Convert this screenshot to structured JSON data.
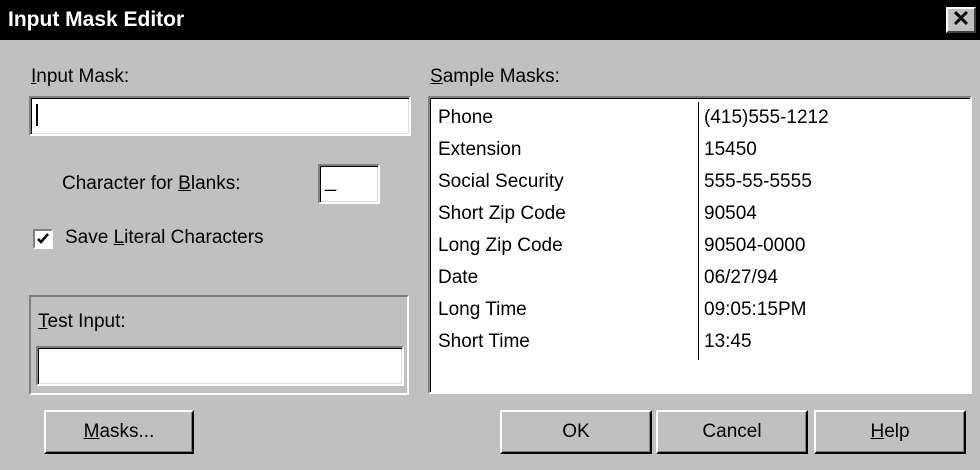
{
  "window": {
    "title": "Input Mask Editor",
    "close_glyph": "✕"
  },
  "input_mask": {
    "label_accel": "I",
    "label_rest": "nput Mask:",
    "value": ""
  },
  "blanks": {
    "label_pre": "Character for ",
    "label_accel": "B",
    "label_post": "lanks:",
    "value": "_"
  },
  "save_literal": {
    "label_pre": "Save ",
    "label_accel": "L",
    "label_post": "iteral Characters",
    "checked": true
  },
  "test_input": {
    "label_accel": "T",
    "label_rest": "est Input:",
    "value": ""
  },
  "sample_masks": {
    "label_accel": "S",
    "label_rest": "ample Masks:",
    "rows": [
      {
        "name": "Phone",
        "sample": "(415)555-1212"
      },
      {
        "name": "Extension",
        "sample": "15450"
      },
      {
        "name": "Social Security",
        "sample": "555-55-5555"
      },
      {
        "name": "Short Zip Code",
        "sample": "90504"
      },
      {
        "name": "Long Zip Code",
        "sample": "90504-0000"
      },
      {
        "name": "Date",
        "sample": "06/27/94"
      },
      {
        "name": "Long Time",
        "sample": "09:05:15PM"
      },
      {
        "name": "Short Time",
        "sample": "13:45"
      }
    ]
  },
  "buttons": {
    "masks_accel": "M",
    "masks_rest": "asks...",
    "ok": "OK",
    "cancel": "Cancel",
    "help_accel": "H",
    "help_rest": "elp"
  }
}
